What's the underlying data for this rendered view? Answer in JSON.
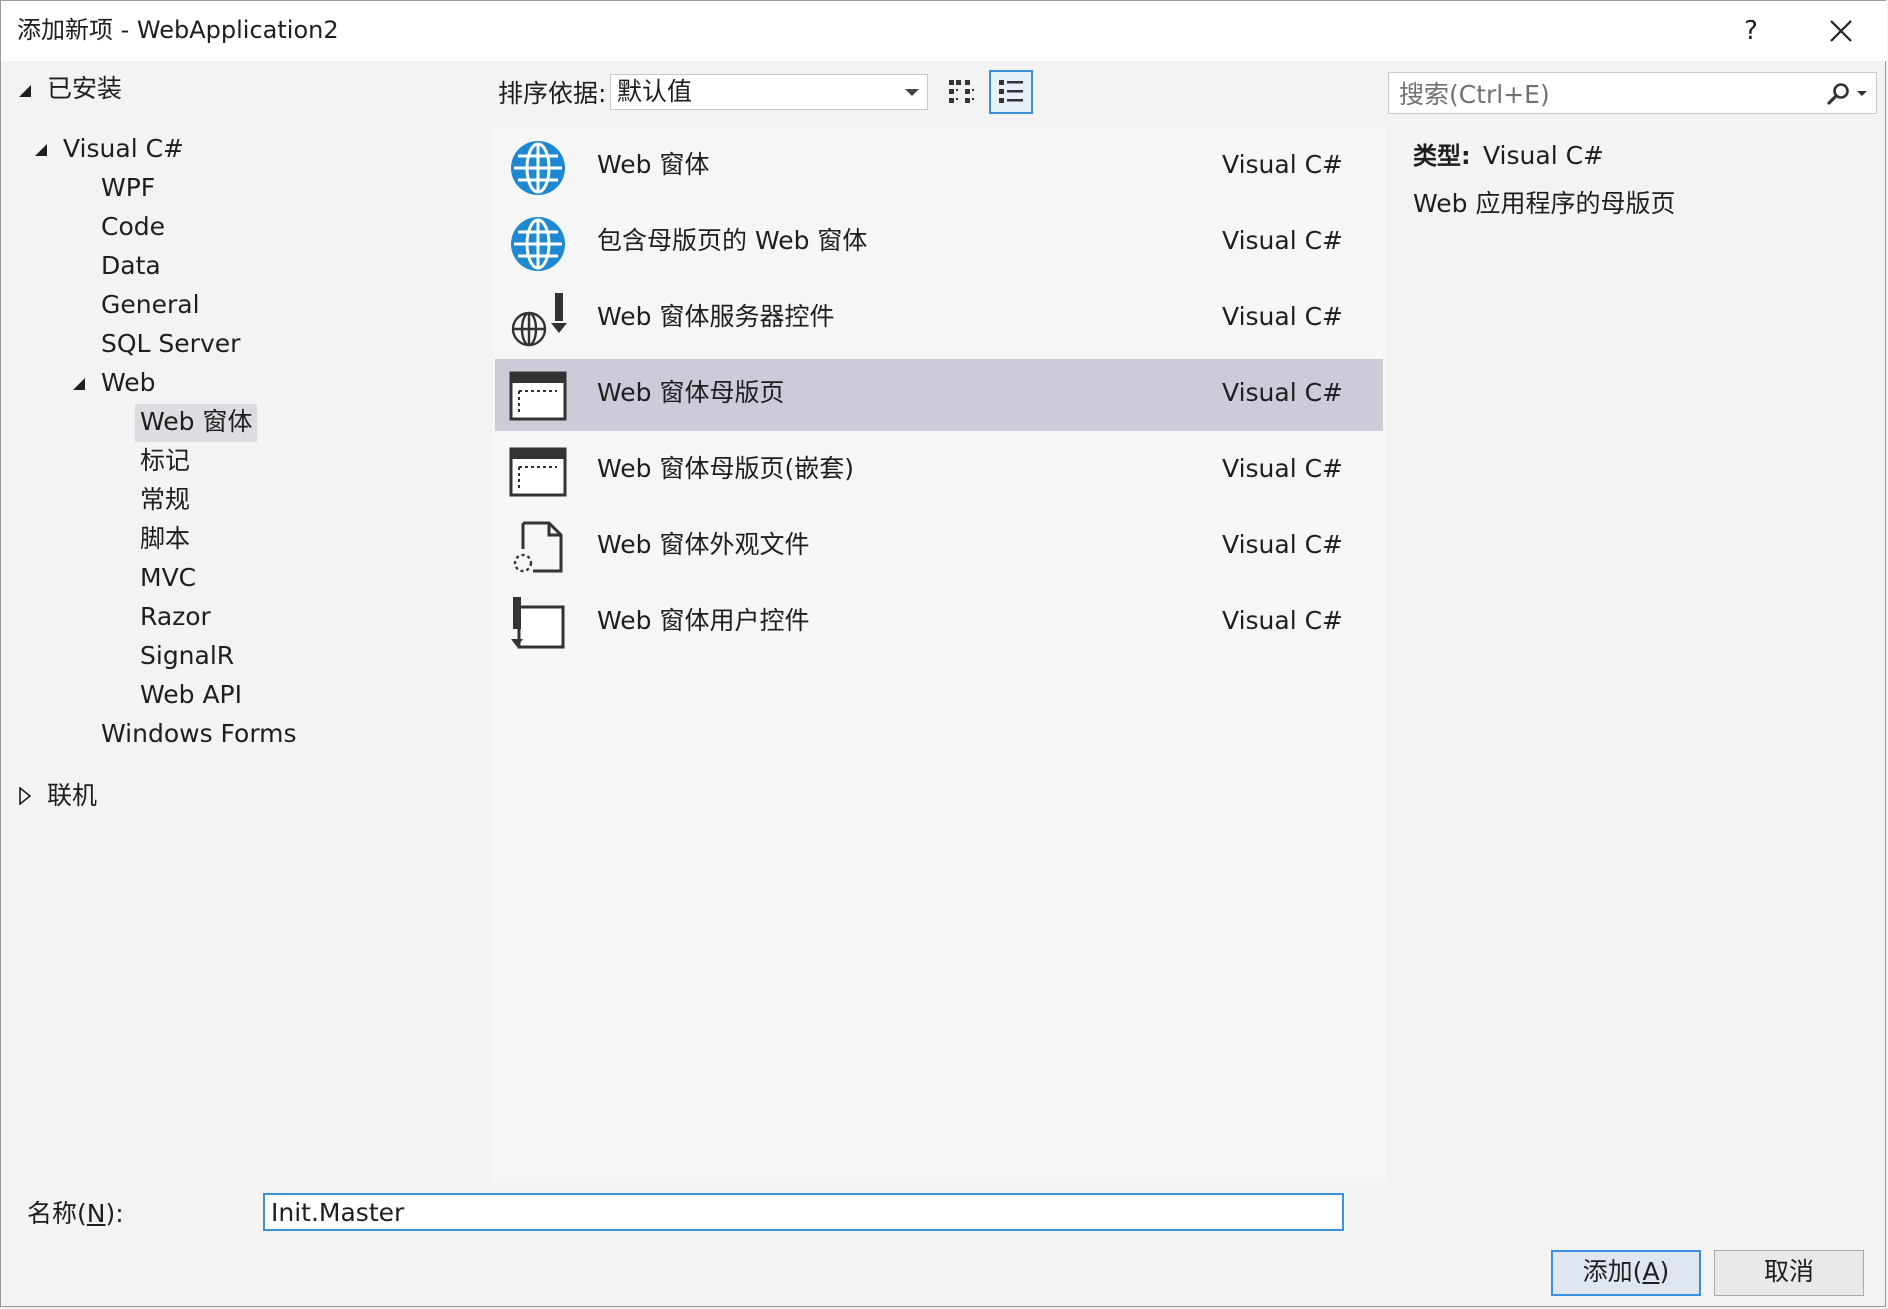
{
  "window": {
    "title": "添加新项 - WebApplication2",
    "help_label": "?"
  },
  "tree": {
    "installed": "已安装",
    "visual_csharp": "Visual C#",
    "children": [
      "WPF",
      "Code",
      "Data",
      "General",
      "SQL Server"
    ],
    "web": "Web",
    "web_children": [
      "Web 窗体",
      "标记",
      "常规",
      "脚本",
      "MVC",
      "Razor",
      "SignalR",
      "Web API"
    ],
    "windows_forms": "Windows Forms",
    "online": "联机"
  },
  "toolbar": {
    "sort_label": "排序依据:",
    "sort_value": "默认值",
    "search_placeholder": "搜索(Ctrl+E)"
  },
  "templates": [
    {
      "name": "Web 窗体",
      "type": "Visual C#",
      "icon": "globe-icon"
    },
    {
      "name": "包含母版页的 Web 窗体",
      "type": "Visual C#",
      "icon": "globe-icon"
    },
    {
      "name": "Web 窗体服务器控件",
      "type": "Visual C#",
      "icon": "globe-control-icon"
    },
    {
      "name": "Web 窗体母版页",
      "type": "Visual C#",
      "icon": "master-page-icon"
    },
    {
      "name": "Web 窗体母版页(嵌套)",
      "type": "Visual C#",
      "icon": "master-page-icon"
    },
    {
      "name": "Web 窗体外观文件",
      "type": "Visual C#",
      "icon": "skin-file-icon"
    },
    {
      "name": "Web 窗体用户控件",
      "type": "Visual C#",
      "icon": "user-control-icon"
    }
  ],
  "selected_template_index": 3,
  "info": {
    "type_label": "类型:",
    "type_value": "Visual C#",
    "description": "Web 应用程序的母版页"
  },
  "footer": {
    "name_label_pre": "名称(",
    "name_label_key": "N",
    "name_label_post": "):",
    "name_value": "Init.Master",
    "add_pre": "添加(",
    "add_key": "A",
    "add_post": ")",
    "cancel": "取消"
  },
  "colors": {
    "accent": "#3c8fd9",
    "selection": "#cbccd8",
    "globe": "#1e88d0"
  }
}
